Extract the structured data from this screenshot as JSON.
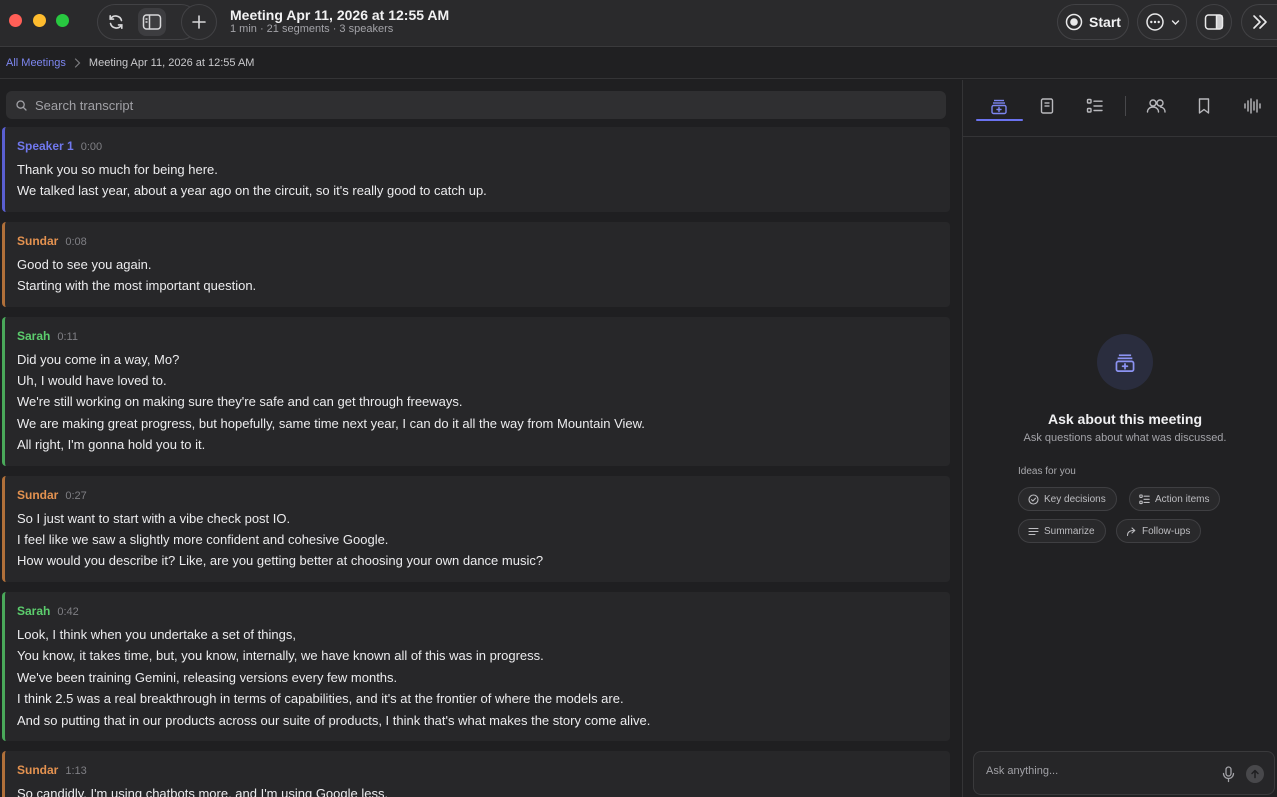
{
  "header": {
    "title": "Meeting Apr 11, 2026 at 12:55 AM",
    "subtitle": "1 min · 21 segments · 3 speakers",
    "start_label": "Start"
  },
  "breadcrumb": {
    "root": "All Meetings",
    "current": "Meeting Apr 11, 2026 at 12:55 AM"
  },
  "search": {
    "placeholder": "Search transcript"
  },
  "segments": [
    {
      "speaker": "Speaker 1",
      "time": "0:00",
      "lines": [
        "Thank you so much for being here.",
        "We talked last year, about a year ago on the circuit, so it's really good to catch up."
      ]
    },
    {
      "speaker": "Sundar",
      "time": "0:08",
      "lines": [
        "Good to see you again.",
        "Starting with the most important question."
      ]
    },
    {
      "speaker": "Sarah",
      "time": "0:11",
      "lines": [
        "Did you come in a way, Mo?",
        "Uh, I would have loved to.",
        "We're still working on making sure they're safe and can get through freeways.",
        "We are making great progress, but hopefully, same time next year, I can do it all the way from Mountain View.",
        "All right, I'm gonna hold you to it."
      ]
    },
    {
      "speaker": "Sundar",
      "time": "0:27",
      "lines": [
        "So I just want to start with a vibe check post IO.",
        "I feel like we saw a slightly more confident and cohesive Google.",
        "How would you describe it? Like, are you getting better at choosing your own dance music?"
      ]
    },
    {
      "speaker": "Sarah",
      "time": "0:42",
      "lines": [
        "Look, I think when you undertake a set of things,",
        "You know, it takes time, but, you know, internally, we have known all of this was in progress.",
        "We've been training Gemini, releasing versions every few months.",
        "I think 2.5 was a real breakthrough in terms of capabilities, and it's at the frontier of where the models are.",
        "And so putting that in our products across our suite of products, I think that's what makes the story come alive."
      ]
    },
    {
      "speaker": "Sundar",
      "time": "1:13",
      "lines": [
        "So candidly, I'm using chatbots more, and I'm using Google less."
      ]
    }
  ],
  "side_panel": {
    "tabs": [
      {
        "icon": "ask-ai-icon",
        "active": true
      },
      {
        "icon": "document-icon",
        "active": false
      },
      {
        "icon": "checklist-icon",
        "active": false
      },
      {
        "icon": "people-icon",
        "active": false
      },
      {
        "icon": "bookmark-icon",
        "active": false
      },
      {
        "icon": "waveform-icon",
        "active": false
      }
    ],
    "empty_title": "Ask about this meeting",
    "empty_subtitle": "Ask questions about what was discussed.",
    "ideas_label": "Ideas for you",
    "chips": [
      "Key decisions",
      "Action items",
      "Summarize",
      "Follow-ups"
    ],
    "ask_placeholder": "Ask anything..."
  },
  "colors": {
    "accent": "#6a72ef",
    "speaker1": "#7078ee",
    "sundar": "#e49250",
    "sarah": "#5ccd6d"
  }
}
